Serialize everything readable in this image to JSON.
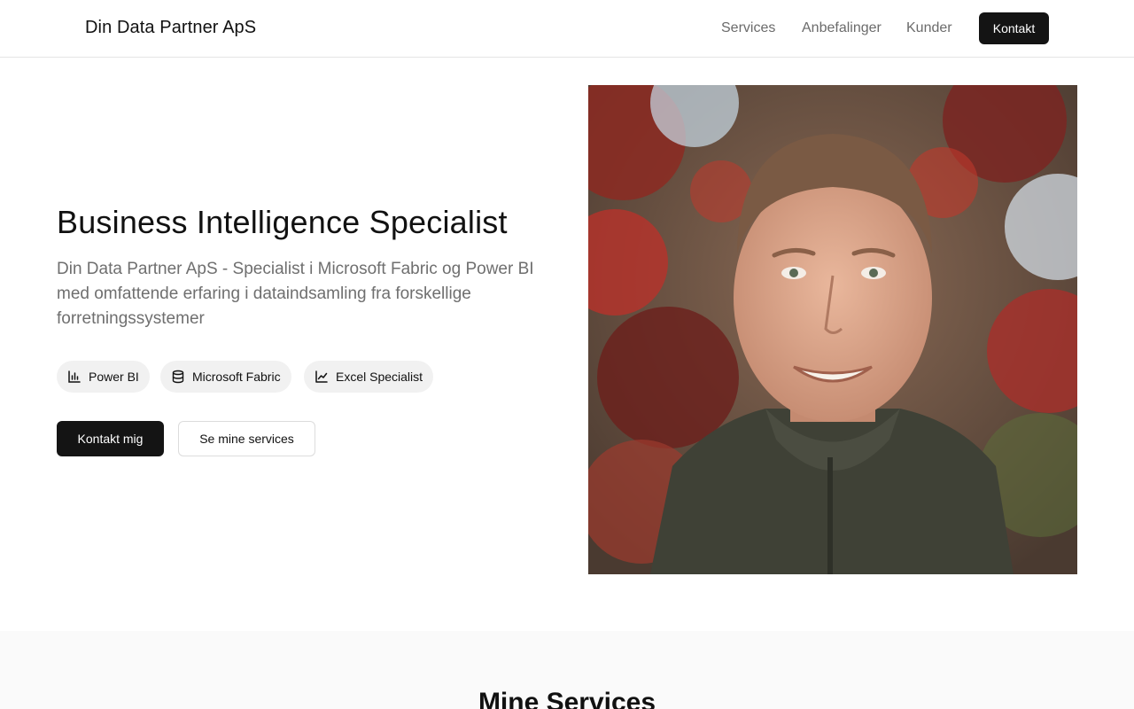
{
  "header": {
    "brand": "Din Data Partner ApS",
    "nav": [
      "Services",
      "Anbefalinger",
      "Kunder"
    ],
    "cta": "Kontakt"
  },
  "hero": {
    "title": "Business Intelligence Specialist",
    "subtitle": "Din Data Partner ApS - Specialist i Microsoft Fabric og Power BI med omfattende erfaring i dataindsamling fra forskellige forretningssystemer",
    "badges": [
      {
        "label": "Power BI",
        "icon": "bar-chart-icon"
      },
      {
        "label": "Microsoft Fabric",
        "icon": "database-icon"
      },
      {
        "label": "Excel Specialist",
        "icon": "line-chart-icon"
      }
    ],
    "primary_button": "Kontakt mig",
    "secondary_button": "Se mine services",
    "photo_alt": "portrait-photo"
  },
  "services": {
    "title": "Mine Services"
  },
  "colors": {
    "primary": "#141414",
    "muted_text": "#6f6f6f",
    "badge_bg": "#f1f1f1",
    "section_bg": "#fafafa"
  }
}
